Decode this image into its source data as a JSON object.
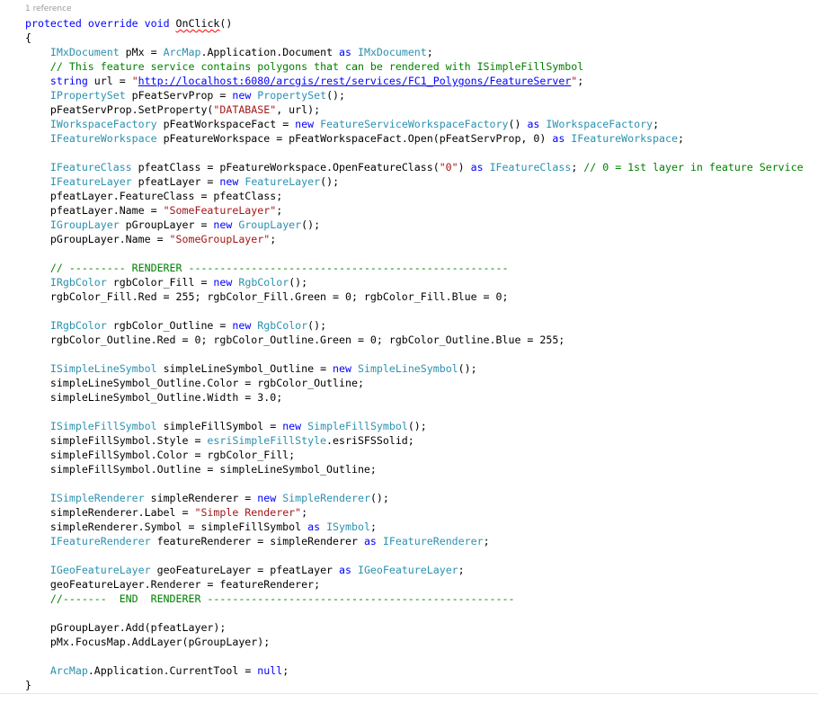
{
  "codelens": {
    "text": "1 reference"
  },
  "lines": [
    [
      {
        "t": "protected",
        "c": "kw"
      },
      {
        "t": " ",
        "c": "plain"
      },
      {
        "t": "override",
        "c": "kw"
      },
      {
        "t": " ",
        "c": "plain"
      },
      {
        "t": "void",
        "c": "kw"
      },
      {
        "t": " ",
        "c": "plain"
      },
      {
        "t": "OnClick",
        "c": "plain squiggle"
      },
      {
        "t": "()",
        "c": "plain"
      }
    ],
    [
      {
        "t": "{",
        "c": "plain"
      }
    ],
    [
      {
        "t": "    ",
        "c": "plain"
      },
      {
        "t": "IMxDocument",
        "c": "ty"
      },
      {
        "t": " pMx = ",
        "c": "plain"
      },
      {
        "t": "ArcMap",
        "c": "ty"
      },
      {
        "t": ".Application.Document ",
        "c": "plain"
      },
      {
        "t": "as",
        "c": "kw"
      },
      {
        "t": " ",
        "c": "plain"
      },
      {
        "t": "IMxDocument",
        "c": "ty"
      },
      {
        "t": ";",
        "c": "plain"
      }
    ],
    [
      {
        "t": "    ",
        "c": "plain"
      },
      {
        "t": "// This feature service contains polygons that can be rendered with ISimpleFillSymbol",
        "c": "cm"
      }
    ],
    [
      {
        "t": "    ",
        "c": "plain"
      },
      {
        "t": "string",
        "c": "kw"
      },
      {
        "t": " url = ",
        "c": "plain"
      },
      {
        "t": "\"",
        "c": "str"
      },
      {
        "t": "http://localhost:6080/arcgis/rest/services/FC1_Polygons/FeatureServer",
        "c": "url"
      },
      {
        "t": "\"",
        "c": "str"
      },
      {
        "t": ";",
        "c": "plain"
      }
    ],
    [
      {
        "t": "    ",
        "c": "plain"
      },
      {
        "t": "IPropertySet",
        "c": "ty"
      },
      {
        "t": " pFeatServProp = ",
        "c": "plain"
      },
      {
        "t": "new",
        "c": "kw"
      },
      {
        "t": " ",
        "c": "plain"
      },
      {
        "t": "PropertySet",
        "c": "ty"
      },
      {
        "t": "();",
        "c": "plain"
      }
    ],
    [
      {
        "t": "    pFeatServProp.SetProperty(",
        "c": "plain"
      },
      {
        "t": "\"DATABASE\"",
        "c": "str"
      },
      {
        "t": ", url);",
        "c": "plain"
      }
    ],
    [
      {
        "t": "    ",
        "c": "plain"
      },
      {
        "t": "IWorkspaceFactory",
        "c": "ty"
      },
      {
        "t": " pFeatWorkspaceFact = ",
        "c": "plain"
      },
      {
        "t": "new",
        "c": "kw"
      },
      {
        "t": " ",
        "c": "plain"
      },
      {
        "t": "FeatureServiceWorkspaceFactory",
        "c": "ty"
      },
      {
        "t": "() ",
        "c": "plain"
      },
      {
        "t": "as",
        "c": "kw"
      },
      {
        "t": " ",
        "c": "plain"
      },
      {
        "t": "IWorkspaceFactory",
        "c": "ty"
      },
      {
        "t": ";",
        "c": "plain"
      }
    ],
    [
      {
        "t": "    ",
        "c": "plain"
      },
      {
        "t": "IFeatureWorkspace",
        "c": "ty"
      },
      {
        "t": " pFeatureWorkspace = pFeatWorkspaceFact.Open(pFeatServProp, 0) ",
        "c": "plain"
      },
      {
        "t": "as",
        "c": "kw"
      },
      {
        "t": " ",
        "c": "plain"
      },
      {
        "t": "IFeatureWorkspace",
        "c": "ty"
      },
      {
        "t": ";",
        "c": "plain"
      }
    ],
    [
      {
        "t": "",
        "c": "plain"
      }
    ],
    [
      {
        "t": "    ",
        "c": "plain"
      },
      {
        "t": "IFeatureClass",
        "c": "ty"
      },
      {
        "t": " pfeatClass = pFeatureWorkspace.OpenFeatureClass(",
        "c": "plain"
      },
      {
        "t": "\"0\"",
        "c": "str"
      },
      {
        "t": ") ",
        "c": "plain"
      },
      {
        "t": "as",
        "c": "kw"
      },
      {
        "t": " ",
        "c": "plain"
      },
      {
        "t": "IFeatureClass",
        "c": "ty"
      },
      {
        "t": "; ",
        "c": "plain"
      },
      {
        "t": "// 0 = 1st layer in feature Service",
        "c": "cm"
      }
    ],
    [
      {
        "t": "    ",
        "c": "plain"
      },
      {
        "t": "IFeatureLayer",
        "c": "ty"
      },
      {
        "t": " pfeatLayer = ",
        "c": "plain"
      },
      {
        "t": "new",
        "c": "kw"
      },
      {
        "t": " ",
        "c": "plain"
      },
      {
        "t": "FeatureLayer",
        "c": "ty"
      },
      {
        "t": "();",
        "c": "plain"
      }
    ],
    [
      {
        "t": "    pfeatLayer.FeatureClass = pfeatClass;",
        "c": "plain"
      }
    ],
    [
      {
        "t": "    pfeatLayer.Name = ",
        "c": "plain"
      },
      {
        "t": "\"SomeFeatureLayer\"",
        "c": "str"
      },
      {
        "t": ";",
        "c": "plain"
      }
    ],
    [
      {
        "t": "    ",
        "c": "plain"
      },
      {
        "t": "IGroupLayer",
        "c": "ty"
      },
      {
        "t": " pGroupLayer = ",
        "c": "plain"
      },
      {
        "t": "new",
        "c": "kw"
      },
      {
        "t": " ",
        "c": "plain"
      },
      {
        "t": "GroupLayer",
        "c": "ty"
      },
      {
        "t": "();",
        "c": "plain"
      }
    ],
    [
      {
        "t": "    pGroupLayer.Name = ",
        "c": "plain"
      },
      {
        "t": "\"SomeGroupLayer\"",
        "c": "str"
      },
      {
        "t": ";",
        "c": "plain"
      }
    ],
    [
      {
        "t": "",
        "c": "plain"
      }
    ],
    [
      {
        "t": "    ",
        "c": "plain"
      },
      {
        "t": "// --------- RENDERER ---------------------------------------------------",
        "c": "cm"
      }
    ],
    [
      {
        "t": "    ",
        "c": "plain"
      },
      {
        "t": "IRgbColor",
        "c": "ty"
      },
      {
        "t": " rgbColor_Fill = ",
        "c": "plain"
      },
      {
        "t": "new",
        "c": "kw"
      },
      {
        "t": " ",
        "c": "plain"
      },
      {
        "t": "RgbColor",
        "c": "ty"
      },
      {
        "t": "();",
        "c": "plain"
      }
    ],
    [
      {
        "t": "    rgbColor_Fill.Red = 255; rgbColor_Fill.Green = 0; rgbColor_Fill.Blue = 0;",
        "c": "plain"
      }
    ],
    [
      {
        "t": "",
        "c": "plain"
      }
    ],
    [
      {
        "t": "    ",
        "c": "plain"
      },
      {
        "t": "IRgbColor",
        "c": "ty"
      },
      {
        "t": " rgbColor_Outline = ",
        "c": "plain"
      },
      {
        "t": "new",
        "c": "kw"
      },
      {
        "t": " ",
        "c": "plain"
      },
      {
        "t": "RgbColor",
        "c": "ty"
      },
      {
        "t": "();",
        "c": "plain"
      }
    ],
    [
      {
        "t": "    rgbColor_Outline.Red = 0; rgbColor_Outline.Green = 0; rgbColor_Outline.Blue = 255;",
        "c": "plain"
      }
    ],
    [
      {
        "t": "",
        "c": "plain"
      }
    ],
    [
      {
        "t": "    ",
        "c": "plain"
      },
      {
        "t": "ISimpleLineSymbol",
        "c": "ty"
      },
      {
        "t": " simpleLineSymbol_Outline = ",
        "c": "plain"
      },
      {
        "t": "new",
        "c": "kw"
      },
      {
        "t": " ",
        "c": "plain"
      },
      {
        "t": "SimpleLineSymbol",
        "c": "ty"
      },
      {
        "t": "();",
        "c": "plain"
      }
    ],
    [
      {
        "t": "    simpleLineSymbol_Outline.Color = rgbColor_Outline;",
        "c": "plain"
      }
    ],
    [
      {
        "t": "    simpleLineSymbol_Outline.Width = 3.0;",
        "c": "plain"
      }
    ],
    [
      {
        "t": "",
        "c": "plain"
      }
    ],
    [
      {
        "t": "    ",
        "c": "plain"
      },
      {
        "t": "ISimpleFillSymbol",
        "c": "ty"
      },
      {
        "t": " simpleFillSymbol = ",
        "c": "plain"
      },
      {
        "t": "new",
        "c": "kw"
      },
      {
        "t": " ",
        "c": "plain"
      },
      {
        "t": "SimpleFillSymbol",
        "c": "ty"
      },
      {
        "t": "();",
        "c": "plain"
      }
    ],
    [
      {
        "t": "    simpleFillSymbol.Style = ",
        "c": "plain"
      },
      {
        "t": "esriSimpleFillStyle",
        "c": "ty"
      },
      {
        "t": ".esriSFSSolid;",
        "c": "plain"
      }
    ],
    [
      {
        "t": "    simpleFillSymbol.Color = rgbColor_Fill;",
        "c": "plain"
      }
    ],
    [
      {
        "t": "    simpleFillSymbol.Outline = simpleLineSymbol_Outline;",
        "c": "plain"
      }
    ],
    [
      {
        "t": "",
        "c": "plain"
      }
    ],
    [
      {
        "t": "    ",
        "c": "plain"
      },
      {
        "t": "ISimpleRenderer",
        "c": "ty"
      },
      {
        "t": " simpleRenderer = ",
        "c": "plain"
      },
      {
        "t": "new",
        "c": "kw"
      },
      {
        "t": " ",
        "c": "plain"
      },
      {
        "t": "SimpleRenderer",
        "c": "ty"
      },
      {
        "t": "();",
        "c": "plain"
      }
    ],
    [
      {
        "t": "    simpleRenderer.Label = ",
        "c": "plain"
      },
      {
        "t": "\"Simple Renderer\"",
        "c": "str"
      },
      {
        "t": ";",
        "c": "plain"
      }
    ],
    [
      {
        "t": "    simpleRenderer.Symbol = simpleFillSymbol ",
        "c": "plain"
      },
      {
        "t": "as",
        "c": "kw"
      },
      {
        "t": " ",
        "c": "plain"
      },
      {
        "t": "ISymbol",
        "c": "ty"
      },
      {
        "t": ";",
        "c": "plain"
      }
    ],
    [
      {
        "t": "    ",
        "c": "plain"
      },
      {
        "t": "IFeatureRenderer",
        "c": "ty"
      },
      {
        "t": " featureRenderer = simpleRenderer ",
        "c": "plain"
      },
      {
        "t": "as",
        "c": "kw"
      },
      {
        "t": " ",
        "c": "plain"
      },
      {
        "t": "IFeatureRenderer",
        "c": "ty"
      },
      {
        "t": ";",
        "c": "plain"
      }
    ],
    [
      {
        "t": "",
        "c": "plain"
      }
    ],
    [
      {
        "t": "    ",
        "c": "plain"
      },
      {
        "t": "IGeoFeatureLayer",
        "c": "ty"
      },
      {
        "t": " geoFeatureLayer = pfeatLayer ",
        "c": "plain"
      },
      {
        "t": "as",
        "c": "kw"
      },
      {
        "t": " ",
        "c": "plain"
      },
      {
        "t": "IGeoFeatureLayer",
        "c": "ty"
      },
      {
        "t": ";",
        "c": "plain"
      }
    ],
    [
      {
        "t": "    geoFeatureLayer.Renderer = featureRenderer;",
        "c": "plain"
      }
    ],
    [
      {
        "t": "    ",
        "c": "plain"
      },
      {
        "t": "//-------  END  RENDERER -------------------------------------------------",
        "c": "cm"
      }
    ],
    [
      {
        "t": "",
        "c": "plain"
      }
    ],
    [
      {
        "t": "    pGroupLayer.Add(pfeatLayer);",
        "c": "plain"
      }
    ],
    [
      {
        "t": "    pMx.FocusMap.AddLayer(pGroupLayer);",
        "c": "plain"
      }
    ],
    [
      {
        "t": "",
        "c": "plain"
      }
    ],
    [
      {
        "t": "    ",
        "c": "plain"
      },
      {
        "t": "ArcMap",
        "c": "ty"
      },
      {
        "t": ".Application.CurrentTool = ",
        "c": "plain"
      },
      {
        "t": "null",
        "c": "kw"
      },
      {
        "t": ";",
        "c": "plain"
      }
    ],
    [
      {
        "t": "}",
        "c": "plain"
      }
    ]
  ]
}
